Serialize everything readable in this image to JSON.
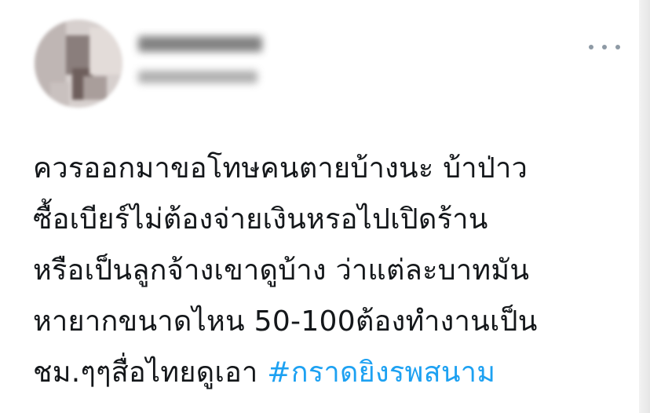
{
  "tweet": {
    "lines": [
      "ควรออกมาขอโทษคนตายบ้างนะ บ้าป่าว",
      "ซื้อเบียร์ไม่ต้องจ่ายเงินหรอไปเปิดร้าน",
      "หรือเป็นลูกจ้างเขาดูบ้าง ว่าแต่ละบาทมัน",
      "หายากขนาดไหน 50-100ต้องทำงานเป็น"
    ],
    "last_line_text": "ชม.ๆๆสื่อไทยดูเอา ",
    "hashtag": "#กราดยิงรพสนาม",
    "hashtag_color": "#1da1f2",
    "text_color": "#14171a"
  },
  "icons": {
    "more": "more-horizontal-icon",
    "avatar": "user-avatar"
  }
}
